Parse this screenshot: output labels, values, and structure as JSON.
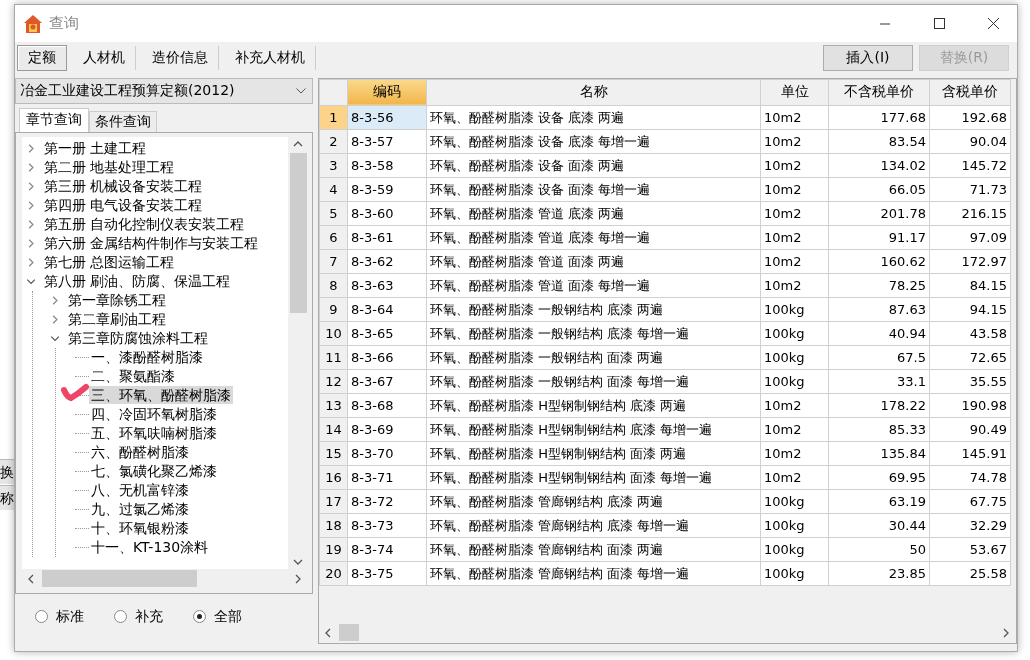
{
  "background_fragments": [
    "换",
    "称"
  ],
  "window": {
    "title": "查询"
  },
  "tabs": [
    {
      "label": "定额",
      "selected": true
    },
    {
      "label": "人材机",
      "selected": false
    },
    {
      "label": "造价信息",
      "selected": false
    },
    {
      "label": "补充人材机",
      "selected": false
    }
  ],
  "buttons": [
    {
      "label": "插入(I)",
      "disabled": false
    },
    {
      "label": "替换(R)",
      "disabled": true
    }
  ],
  "library": {
    "value": "冶金工业建设工程预算定额(2012)"
  },
  "subtabs": [
    {
      "label": "章节查询",
      "selected": true
    },
    {
      "label": "条件查询",
      "selected": false
    }
  ],
  "tree": [
    {
      "label": "第一册 土建工程",
      "kind": "branch",
      "expanded": false,
      "selected": false
    },
    {
      "label": "第二册 地基处理工程",
      "kind": "branch",
      "expanded": false,
      "selected": false
    },
    {
      "label": "第三册 机械设备安装工程",
      "kind": "branch",
      "expanded": false,
      "selected": false
    },
    {
      "label": "第四册 电气设备安装工程",
      "kind": "branch",
      "expanded": false,
      "selected": false
    },
    {
      "label": "第五册 自动化控制仪表安装工程",
      "kind": "branch",
      "expanded": false,
      "selected": false
    },
    {
      "label": "第六册 金属结构件制作与安装工程",
      "kind": "branch",
      "expanded": false,
      "selected": false
    },
    {
      "label": "第七册 总图运输工程",
      "kind": "branch",
      "expanded": false,
      "selected": false
    },
    {
      "label": "第八册 刷油、防腐、保温工程",
      "kind": "branch",
      "expanded": true,
      "selected": false,
      "children": [
        {
          "label": "第一章除锈工程",
          "kind": "branch",
          "expanded": false,
          "selected": false
        },
        {
          "label": "第二章刷油工程",
          "kind": "branch",
          "expanded": false,
          "selected": false
        },
        {
          "label": "第三章防腐蚀涂料工程",
          "kind": "branch",
          "expanded": true,
          "selected": false,
          "children": [
            {
              "label": "一、漆酚醛树脂漆",
              "kind": "leaf",
              "selected": false
            },
            {
              "label": "二、聚氨酯漆",
              "kind": "leaf",
              "selected": false
            },
            {
              "label": "三、环氧、酚醛树脂漆",
              "kind": "leaf",
              "selected": true
            },
            {
              "label": "四、冷固环氧树脂漆",
              "kind": "leaf",
              "selected": false
            },
            {
              "label": "五、环氧呋喃树脂漆",
              "kind": "leaf",
              "selected": false
            },
            {
              "label": "六、酚醛树脂漆",
              "kind": "leaf",
              "selected": false
            },
            {
              "label": "七、氯磺化聚乙烯漆",
              "kind": "leaf",
              "selected": false
            },
            {
              "label": "八、无机富锌漆",
              "kind": "leaf",
              "selected": false
            },
            {
              "label": "九、过氯乙烯漆",
              "kind": "leaf",
              "selected": false
            },
            {
              "label": "十、环氧银粉漆",
              "kind": "leaf",
              "selected": false
            },
            {
              "label": "十一、KT-130涂料",
              "kind": "leaf",
              "selected": false
            }
          ]
        }
      ]
    }
  ],
  "filter": [
    {
      "label": "标准",
      "selected": false
    },
    {
      "label": "补充",
      "selected": false
    },
    {
      "label": "全部",
      "selected": true
    }
  ],
  "table": {
    "columns": [
      {
        "label": "编码",
        "selected": true
      },
      {
        "label": "名称",
        "selected": false
      },
      {
        "label": "单位",
        "selected": false
      },
      {
        "label": "不含税单价",
        "selected": false
      },
      {
        "label": "含税单价",
        "selected": false
      }
    ],
    "rows": [
      {
        "no": "1",
        "code": "8-3-56",
        "name": "环氧、酚醛树脂漆 设备 底漆 两遍",
        "unit": "10m2",
        "price_ex_tax": "177.68",
        "price_inc_tax": "192.68",
        "selected": true
      },
      {
        "no": "2",
        "code": "8-3-57",
        "name": "环氧、酚醛树脂漆 设备 底漆 每增一遍",
        "unit": "10m2",
        "price_ex_tax": "83.54",
        "price_inc_tax": "90.04",
        "selected": false
      },
      {
        "no": "3",
        "code": "8-3-58",
        "name": "环氧、酚醛树脂漆 设备 面漆 两遍",
        "unit": "10m2",
        "price_ex_tax": "134.02",
        "price_inc_tax": "145.72",
        "selected": false
      },
      {
        "no": "4",
        "code": "8-3-59",
        "name": "环氧、酚醛树脂漆 设备 面漆 每增一遍",
        "unit": "10m2",
        "price_ex_tax": "66.05",
        "price_inc_tax": "71.73",
        "selected": false
      },
      {
        "no": "5",
        "code": "8-3-60",
        "name": "环氧、酚醛树脂漆 管道 底漆 两遍",
        "unit": "10m2",
        "price_ex_tax": "201.78",
        "price_inc_tax": "216.15",
        "selected": false
      },
      {
        "no": "6",
        "code": "8-3-61",
        "name": "环氧、酚醛树脂漆 管道 底漆 每增一遍",
        "unit": "10m2",
        "price_ex_tax": "91.17",
        "price_inc_tax": "97.09",
        "selected": false
      },
      {
        "no": "7",
        "code": "8-3-62",
        "name": "环氧、酚醛树脂漆 管道 面漆 两遍",
        "unit": "10m2",
        "price_ex_tax": "160.62",
        "price_inc_tax": "172.97",
        "selected": false
      },
      {
        "no": "8",
        "code": "8-3-63",
        "name": "环氧、酚醛树脂漆 管道 面漆 每增一遍",
        "unit": "10m2",
        "price_ex_tax": "78.25",
        "price_inc_tax": "84.15",
        "selected": false
      },
      {
        "no": "9",
        "code": "8-3-64",
        "name": "环氧、酚醛树脂漆 一般钢结构 底漆 两遍",
        "unit": "100kg",
        "price_ex_tax": "87.63",
        "price_inc_tax": "94.15",
        "selected": false
      },
      {
        "no": "10",
        "code": "8-3-65",
        "name": "环氧、酚醛树脂漆 一般钢结构 底漆 每增一遍",
        "unit": "100kg",
        "price_ex_tax": "40.94",
        "price_inc_tax": "43.58",
        "selected": false
      },
      {
        "no": "11",
        "code": "8-3-66",
        "name": "环氧、酚醛树脂漆 一般钢结构 面漆 两遍",
        "unit": "100kg",
        "price_ex_tax": "67.5",
        "price_inc_tax": "72.65",
        "selected": false
      },
      {
        "no": "12",
        "code": "8-3-67",
        "name": "环氧、酚醛树脂漆 一般钢结构 面漆 每增一遍",
        "unit": "100kg",
        "price_ex_tax": "33.1",
        "price_inc_tax": "35.55",
        "selected": false
      },
      {
        "no": "13",
        "code": "8-3-68",
        "name": "环氧、酚醛树脂漆 H型钢制钢结构 底漆 两遍",
        "unit": "10m2",
        "price_ex_tax": "178.22",
        "price_inc_tax": "190.98",
        "selected": false
      },
      {
        "no": "14",
        "code": "8-3-69",
        "name": "环氧、酚醛树脂漆 H型钢制钢结构 底漆 每增一遍",
        "unit": "10m2",
        "price_ex_tax": "85.33",
        "price_inc_tax": "90.49",
        "selected": false
      },
      {
        "no": "15",
        "code": "8-3-70",
        "name": "环氧、酚醛树脂漆 H型钢制钢结构 面漆 两遍",
        "unit": "10m2",
        "price_ex_tax": "135.84",
        "price_inc_tax": "145.91",
        "selected": false
      },
      {
        "no": "16",
        "code": "8-3-71",
        "name": "环氧、酚醛树脂漆 H型钢制钢结构 面漆 每增一遍",
        "unit": "10m2",
        "price_ex_tax": "69.95",
        "price_inc_tax": "74.78",
        "selected": false
      },
      {
        "no": "17",
        "code": "8-3-72",
        "name": "环氧、酚醛树脂漆 管廊钢结构 底漆 两遍",
        "unit": "100kg",
        "price_ex_tax": "63.19",
        "price_inc_tax": "67.75",
        "selected": false
      },
      {
        "no": "18",
        "code": "8-3-73",
        "name": "环氧、酚醛树脂漆 管廊钢结构 底漆 每增一遍",
        "unit": "100kg",
        "price_ex_tax": "30.44",
        "price_inc_tax": "32.29",
        "selected": false
      },
      {
        "no": "19",
        "code": "8-3-74",
        "name": "环氧、酚醛树脂漆 管廊钢结构 面漆 两遍",
        "unit": "100kg",
        "price_ex_tax": "50",
        "price_inc_tax": "53.67",
        "selected": false
      },
      {
        "no": "20",
        "code": "8-3-75",
        "name": "环氧、酚醛树脂漆 管廊钢结构 面漆 每增一遍",
        "unit": "100kg",
        "price_ex_tax": "23.85",
        "price_inc_tax": "25.58",
        "selected": false
      }
    ]
  }
}
